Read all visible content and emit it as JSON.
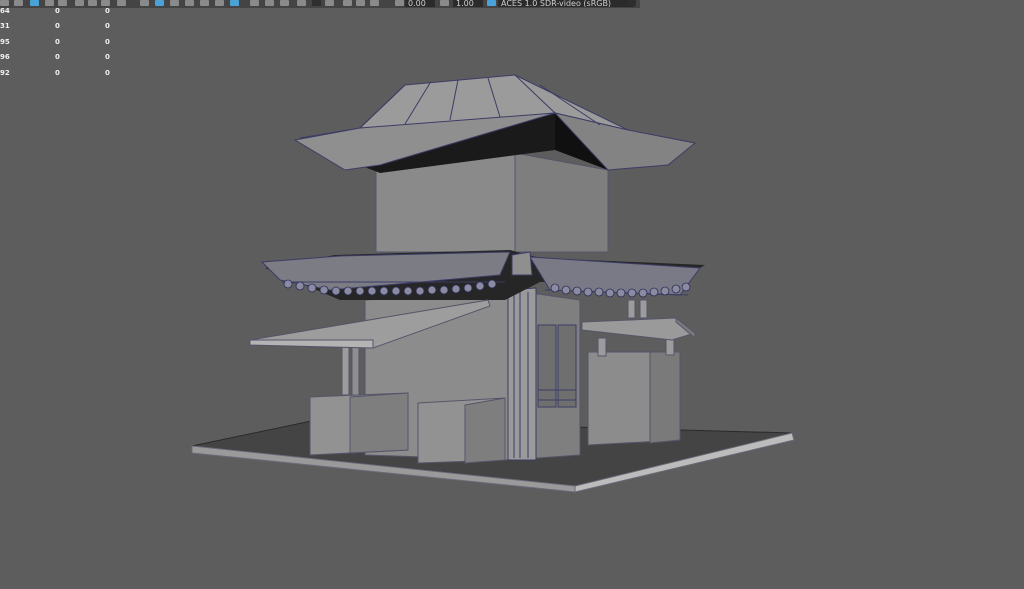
{
  "toolbar": {
    "field_exposure": "0.00",
    "field_gamma": "1.00",
    "colorspace_label": "ACES 1.0 SDR-video (sRGB)"
  },
  "hud": {
    "rows": [
      [
        "64",
        "0",
        "0"
      ],
      [
        "31",
        "0",
        "0"
      ],
      [
        "95",
        "0",
        "0"
      ],
      [
        "96",
        "0",
        "0"
      ],
      [
        "92",
        "0",
        "0"
      ]
    ]
  }
}
